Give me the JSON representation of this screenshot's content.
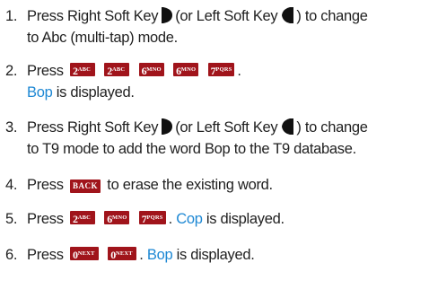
{
  "steps": [
    {
      "num": "1.",
      "a": "Press Right Soft Key",
      "b": "(or Left Soft Key",
      "c": ") to change",
      "line2": "to Abc (multi-tap) mode.",
      "icons": [
        "right-soft-key-icon",
        "left-soft-key-icon"
      ]
    },
    {
      "num": "2.",
      "a": "Press",
      "keys": [
        {
          "main": "2",
          "sup": "ABC"
        },
        {
          "main": "2",
          "sup": "ABC"
        },
        {
          "main": "6",
          "sup": "MNO"
        },
        {
          "main": "6",
          "sup": "MNO"
        },
        {
          "main": "7",
          "sup": "PQRS"
        }
      ],
      "end": ".",
      "line2_blue": "Bop",
      "line2_rest": "is displayed."
    },
    {
      "num": "3.",
      "a": "Press Right Soft Key",
      "b": "(or Left Soft Key",
      "c": ") to change",
      "line2": "to T9 mode to add the word Bop to the T9 database.",
      "icons": [
        "right-soft-key-icon",
        "left-soft-key-icon"
      ]
    },
    {
      "num": "4.",
      "a": "Press",
      "key": "BACK",
      "b": "to erase the existing word."
    },
    {
      "num": "5.",
      "a": "Press",
      "keys": [
        {
          "main": "2",
          "sup": "ABC"
        },
        {
          "main": "6",
          "sup": "MNO"
        },
        {
          "main": "7",
          "sup": "PQRS"
        }
      ],
      "mid": ".",
      "blue": "Cop",
      "rest": "is displayed."
    },
    {
      "num": "6.",
      "a": "Press",
      "keys": [
        {
          "main": "0",
          "sup": "NEXT"
        },
        {
          "main": "0",
          "sup": "NEXT"
        }
      ],
      "mid": ".",
      "blue": "Bop",
      "rest": "is displayed."
    }
  ],
  "colors": {
    "key_bg": "#a0141b",
    "link_blue": "#1e88d4",
    "text": "#1f1f1f"
  }
}
